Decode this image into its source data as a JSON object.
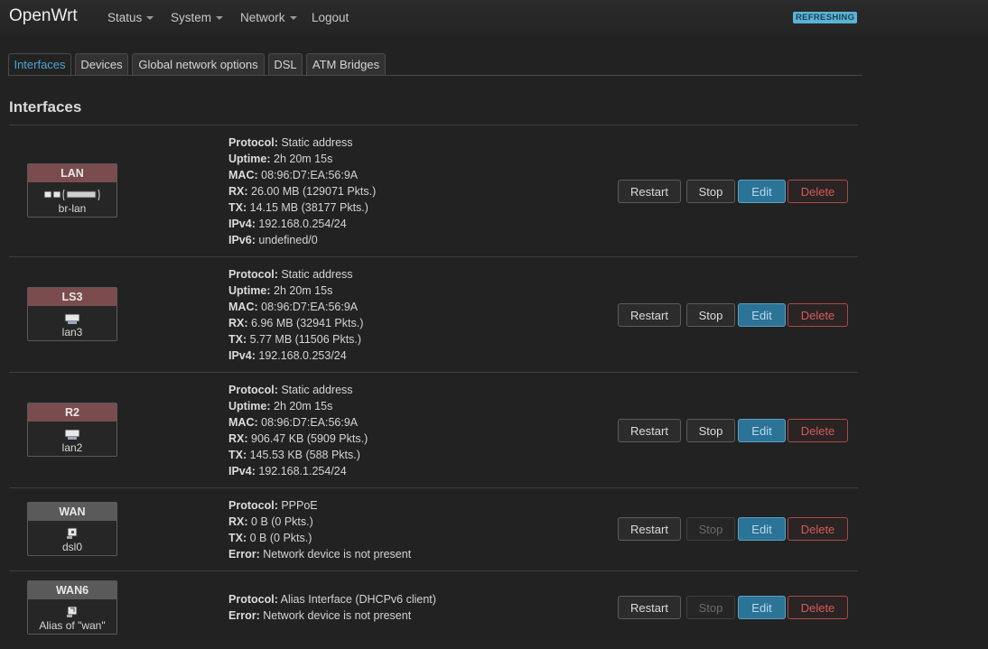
{
  "brand": "OpenWrt",
  "nav": {
    "status": "Status",
    "system": "System",
    "network": "Network",
    "logout": "Logout",
    "refreshing": "REFRESHING"
  },
  "tabs": [
    "Interfaces",
    "Devices",
    "Global network options",
    "DSL",
    "ATM Bridges"
  ],
  "heading": "Interfaces",
  "buttons": {
    "restart": "Restart",
    "stop": "Stop",
    "edit": "Edit",
    "delete": "Delete"
  },
  "interfaces": [
    {
      "name": "LAN",
      "device": "br-lan",
      "color": "#7a4c4e",
      "lines": [
        {
          "k": "Protocol:",
          "v": "Static address"
        },
        {
          "k": "Uptime:",
          "v": "2h 20m 15s"
        },
        {
          "k": "MAC:",
          "v": "08:96:D7:EA:56:9A"
        },
        {
          "k": "RX:",
          "v": "26.00 MB (129071 Pkts.)"
        },
        {
          "k": "TX:",
          "v": "14.15 MB (38177 Pkts.)"
        },
        {
          "k": "IPv4:",
          "v": "192.168.0.254/24"
        },
        {
          "k": "IPv6:",
          "v": "undefined/0"
        }
      ]
    },
    {
      "name": "LS3",
      "device": "lan3",
      "color": "#7a4c4e",
      "lines": [
        {
          "k": "Protocol:",
          "v": "Static address"
        },
        {
          "k": "Uptime:",
          "v": "2h 20m 15s"
        },
        {
          "k": "MAC:",
          "v": "08:96:D7:EA:56:9A"
        },
        {
          "k": "RX:",
          "v": "6.96 MB (32941 Pkts.)"
        },
        {
          "k": "TX:",
          "v": "5.77 MB (11506 Pkts.)"
        },
        {
          "k": "IPv4:",
          "v": "192.168.0.253/24"
        }
      ]
    },
    {
      "name": "R2",
      "device": "lan2",
      "color": "#7a4c4e",
      "lines": [
        {
          "k": "Protocol:",
          "v": "Static address"
        },
        {
          "k": "Uptime:",
          "v": "2h 20m 15s"
        },
        {
          "k": "MAC:",
          "v": "08:96:D7:EA:56:9A"
        },
        {
          "k": "RX:",
          "v": "906.47 KB (5909 Pkts.)"
        },
        {
          "k": "TX:",
          "v": "145.53 KB (588 Pkts.)"
        },
        {
          "k": "IPv4:",
          "v": "192.168.1.254/24"
        }
      ]
    },
    {
      "name": "WAN",
      "device": "dsl0",
      "color": "#5a5a5a",
      "lines": [
        {
          "k": "Protocol:",
          "v": "PPPoE"
        },
        {
          "k": "RX:",
          "v": "0 B (0 Pkts.)"
        },
        {
          "k": "TX:",
          "v": "0 B (0 Pkts.)"
        },
        {
          "k": "Error:",
          "v": "Network device is not present"
        }
      ]
    },
    {
      "name": "WAN6",
      "device": "Alias of \"wan\"",
      "color": "#5a5a5a",
      "lines": [
        {
          "k": "Protocol:",
          "v": "Alias Interface (DHCPv6 client)"
        },
        {
          "k": "Error:",
          "v": "Network device is not present"
        }
      ]
    }
  ]
}
